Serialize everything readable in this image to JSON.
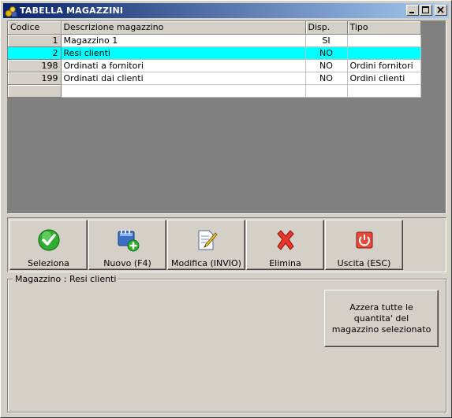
{
  "window": {
    "title": "TABELLA MAGAZZINI",
    "title_icon": "app-icon",
    "controls": [
      "minimize-icon",
      "maximize-icon",
      "close-icon"
    ]
  },
  "grid": {
    "columns": [
      "Codice",
      "Descrizione magazzino",
      "Disp.",
      "Tipo"
    ],
    "rows": [
      {
        "codice": "1",
        "descrizione": "Magazzino 1",
        "disp": "SI",
        "tipo": ""
      },
      {
        "codice": "2",
        "descrizione": "Resi clienti",
        "disp": "NO",
        "tipo": ""
      },
      {
        "codice": "198",
        "descrizione": "Ordinati a fornitori",
        "disp": "NO",
        "tipo": "Ordini fornitori"
      },
      {
        "codice": "199",
        "descrizione": "Ordinati dai clienti",
        "disp": "NO",
        "tipo": "Ordini clienti"
      }
    ],
    "selected_row": 1,
    "selection_color": "#00ffff"
  },
  "toolbar": {
    "buttons": [
      {
        "label": "Seleziona",
        "icon": "check-icon"
      },
      {
        "label": "Nuovo (F4)",
        "icon": "new-record-icon"
      },
      {
        "label": "Modifica (INVIO)",
        "icon": "edit-document-icon"
      },
      {
        "label": "Elimina",
        "icon": "delete-x-icon"
      },
      {
        "label": "Uscita (ESC)",
        "icon": "exit-icon"
      }
    ]
  },
  "detail": {
    "legend": "Magazzino : Resi clienti",
    "reset_button": "Azzera tutte le quantita' del magazzino selezionato"
  },
  "colors": {
    "titlebar_start": "#0a246a",
    "titlebar_end": "#a6caf0",
    "face": "#d4d0c8",
    "grid_background": "#808080"
  }
}
